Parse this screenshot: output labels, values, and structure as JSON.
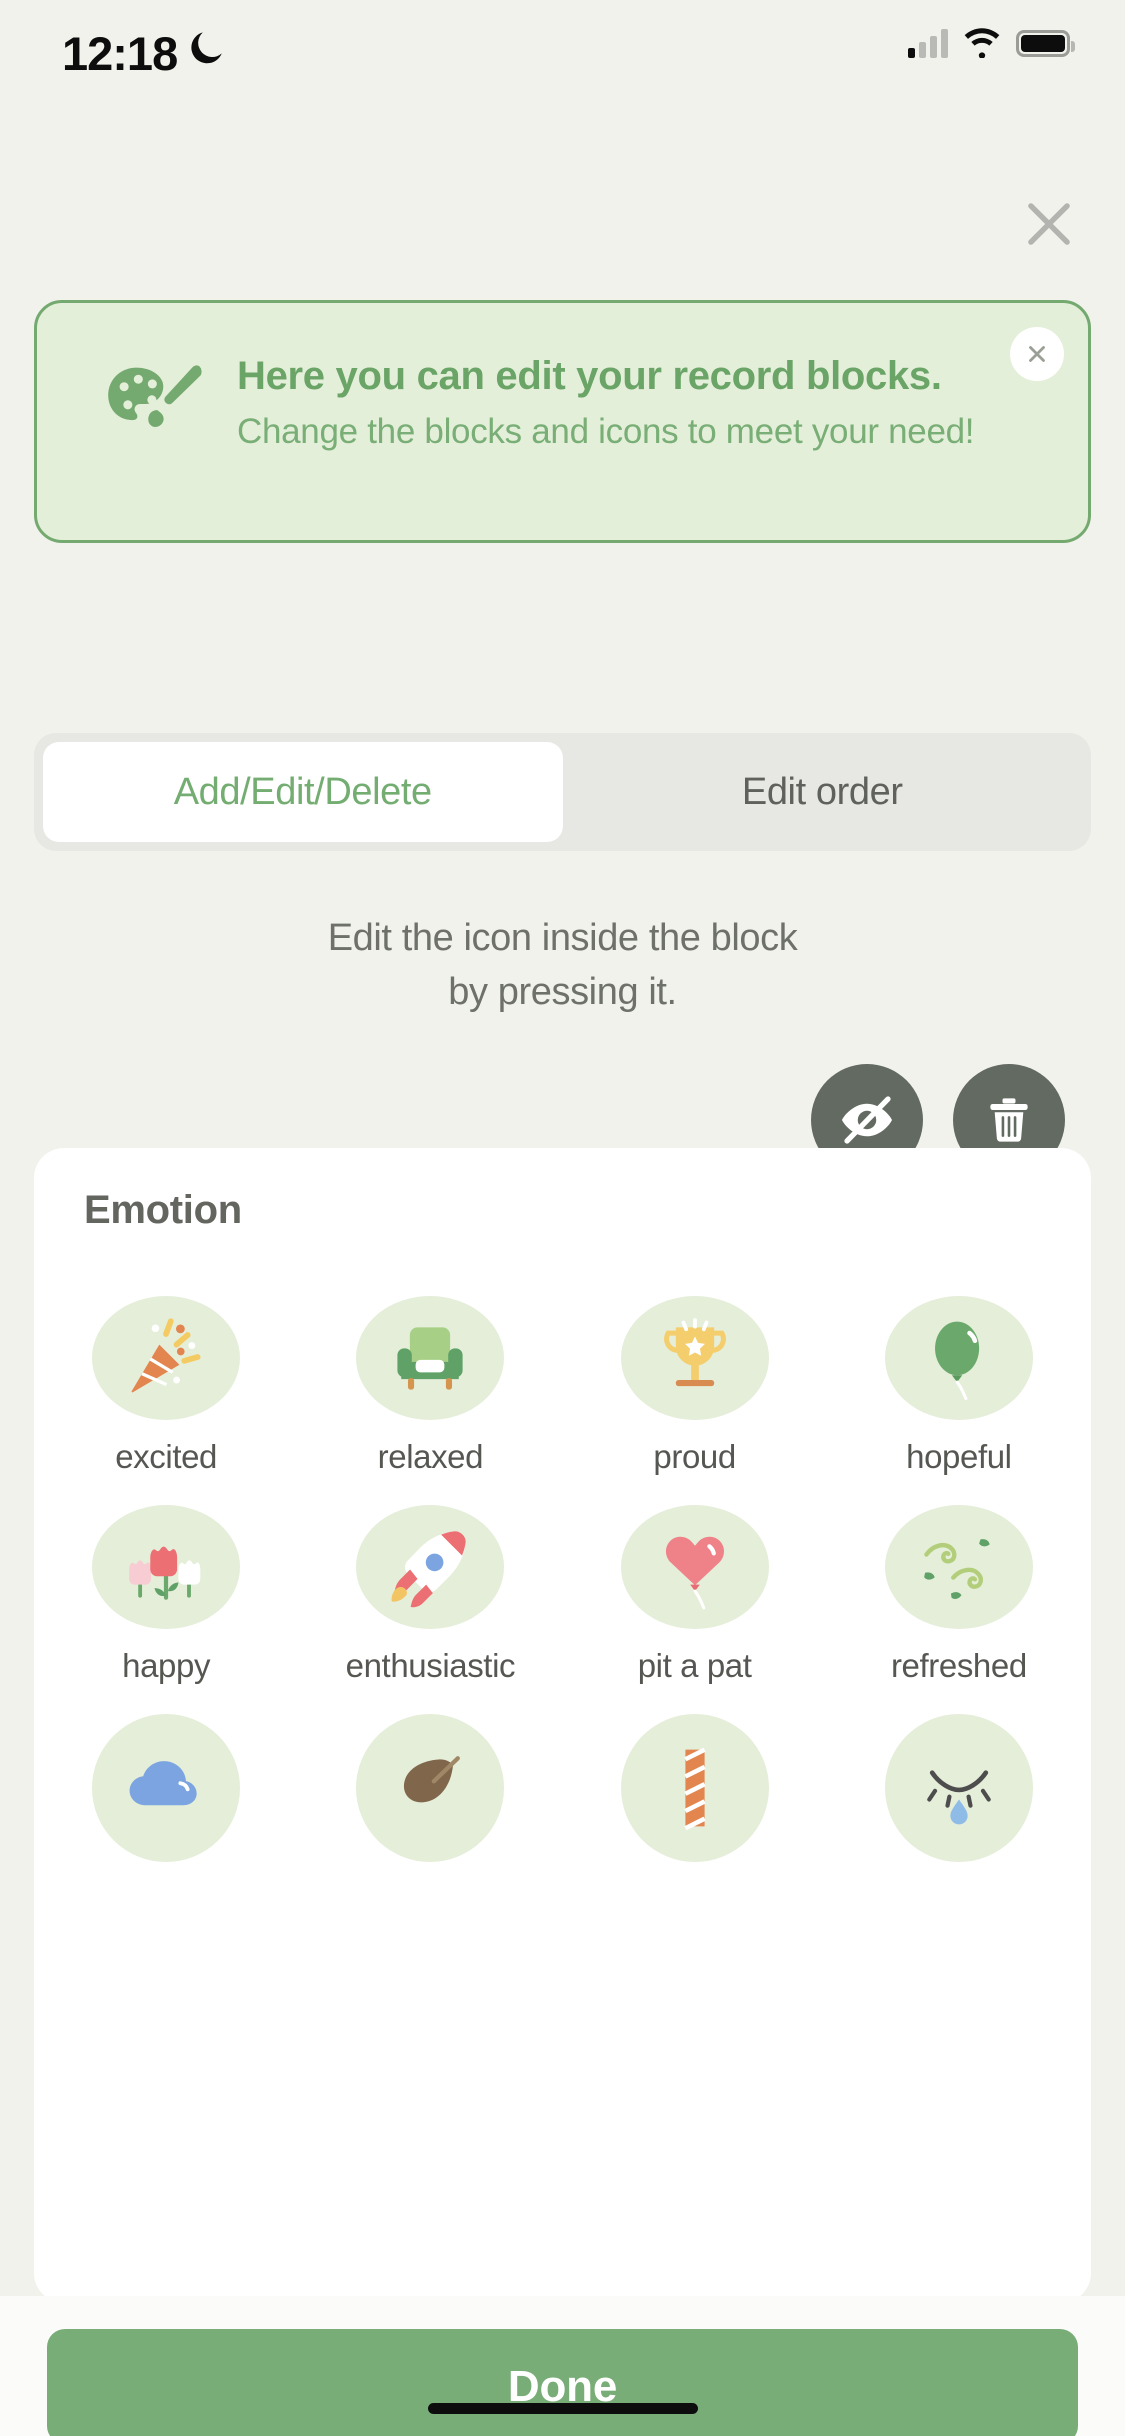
{
  "status_bar": {
    "time": "12:18",
    "dnd_icon": "moon-icon",
    "signal_icon": "cellular-signal-icon",
    "wifi_icon": "wifi-icon",
    "battery_icon": "battery-icon"
  },
  "header": {
    "close_icon": "close-icon"
  },
  "banner": {
    "icon": "palette-paintbrush-icon",
    "title": "Here you can edit your record blocks.",
    "subtitle": "Change the blocks and icons to meet your need!",
    "close_icon": "close-icon",
    "border_color": "#74a96f",
    "background_color": "#e4efd9",
    "title_color": "#6aa467"
  },
  "tabs": {
    "items": [
      {
        "label": "Add/Edit/Delete",
        "active": true
      },
      {
        "label": "Edit order",
        "active": false
      }
    ],
    "active_color": "#74ad71",
    "inactive_color": "#5f615c"
  },
  "hint": {
    "line1": "Edit the icon inside the block",
    "line2": "by pressing it."
  },
  "actions": [
    {
      "name": "hide-button",
      "icon": "eye-off-icon"
    },
    {
      "name": "delete-button",
      "icon": "trash-icon"
    }
  ],
  "card": {
    "title": "Emotion",
    "items": [
      {
        "label": "excited",
        "icon": "party-popper-icon"
      },
      {
        "label": "relaxed",
        "icon": "armchair-icon"
      },
      {
        "label": "proud",
        "icon": "trophy-icon"
      },
      {
        "label": "hopeful",
        "icon": "balloon-icon"
      },
      {
        "label": "happy",
        "icon": "tulips-icon"
      },
      {
        "label": "enthusiastic",
        "icon": "rocket-icon"
      },
      {
        "label": "pit a pat",
        "icon": "heart-balloon-icon"
      },
      {
        "label": "refreshed",
        "icon": "wind-leaves-icon"
      },
      {
        "label": "",
        "icon": "cloud-icon"
      },
      {
        "label": "",
        "icon": "falling-leaf-icon"
      },
      {
        "label": "",
        "icon": "twisted-rope-icon"
      },
      {
        "label": "",
        "icon": "crying-eye-icon"
      }
    ]
  },
  "footer": {
    "done_label": "Done",
    "done_color": "#79ad78"
  }
}
